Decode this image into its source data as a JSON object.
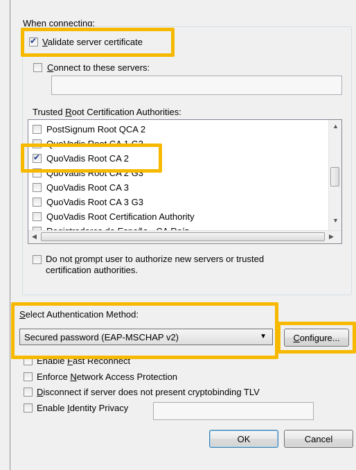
{
  "when_connecting_label": "When connecting:",
  "validate_cert": {
    "pre": "",
    "ul": "V",
    "post": "alidate server certificate",
    "checked": true
  },
  "connect_servers": {
    "pre": "",
    "ul": "C",
    "post": "onnect to these servers:",
    "checked": false,
    "value": ""
  },
  "trusted_root": {
    "pre": "Trusted ",
    "ul": "R",
    "post": "oot Certification Authorities:"
  },
  "ca_list": [
    {
      "label": "PostSignum Root QCA 2",
      "checked": false
    },
    {
      "label": "QuoVadis Root CA 1 G3",
      "checked": false
    },
    {
      "label": "QuoVadis Root CA 2",
      "checked": true
    },
    {
      "label": "QuoVadis Root CA 2 G3",
      "checked": false
    },
    {
      "label": "QuoVadis Root CA 3",
      "checked": false
    },
    {
      "label": "QuoVadis Root CA 3 G3",
      "checked": false
    },
    {
      "label": "QuoVadis Root Certification Authority",
      "checked": false
    },
    {
      "label": "Registradores de España - CA Raíz",
      "checked": false
    }
  ],
  "do_not_prompt": {
    "pre": "Do not ",
    "ul": "p",
    "post": "rompt user to authorize new servers or trusted",
    "line2": "certification authorities.",
    "checked": false
  },
  "auth_method": {
    "pre": "",
    "ul": "S",
    "post": "elect Authentication Method:",
    "selected": "Secured password (EAP-MSCHAP v2)"
  },
  "configure_button": {
    "pre": "",
    "ul": "C",
    "post": "onfigure..."
  },
  "options": [
    {
      "pre": "Enable ",
      "ul": "F",
      "post": "ast Reconnect",
      "checked": false
    },
    {
      "pre": "Enforce ",
      "ul": "N",
      "post": "etwork Access Protection",
      "checked": false
    },
    {
      "pre": "",
      "ul": "D",
      "post": "isconnect if server does not present cryptobinding TLV",
      "checked": false
    },
    {
      "pre": "Enable ",
      "ul": "I",
      "post": "dentity Privacy",
      "checked": false
    }
  ],
  "identity_value": "",
  "ok_label": "OK",
  "cancel_label": "Cancel",
  "highlight_color": "#f7b900"
}
